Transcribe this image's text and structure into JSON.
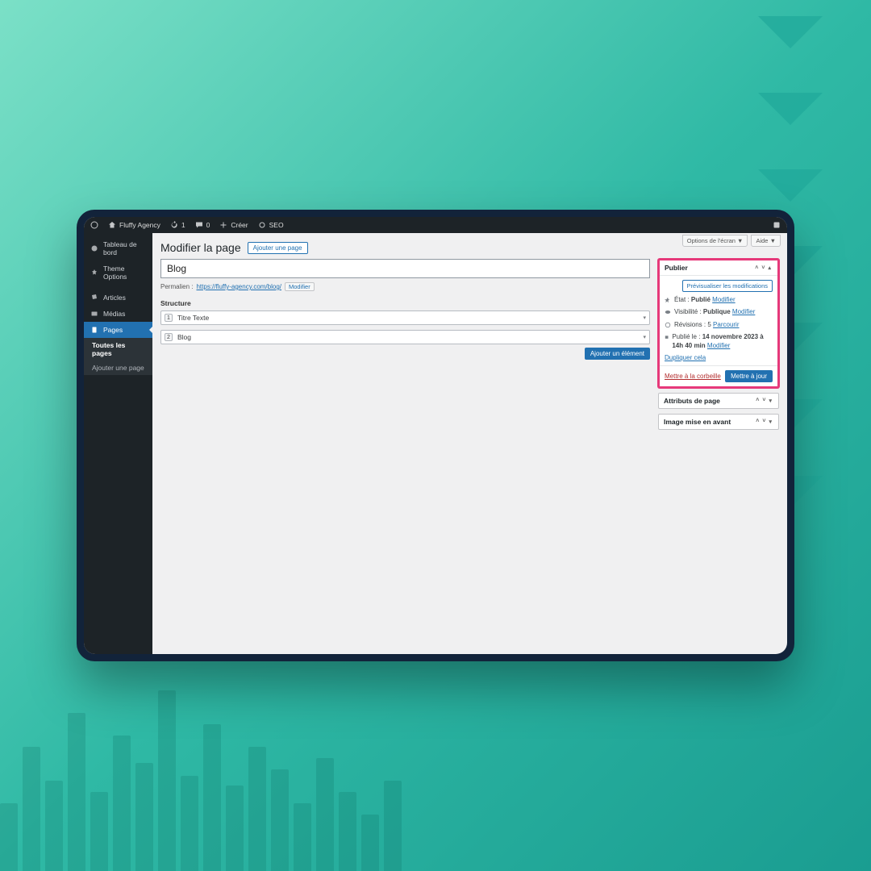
{
  "adminbar": {
    "site_name": "Fluffy Agency",
    "updates_count": "1",
    "comments_count": "0",
    "new_label": "Créer",
    "seo_label": "SEO"
  },
  "sidebar": [
    {
      "id": "dashboard",
      "label": "Tableau de bord"
    },
    {
      "id": "theme",
      "label": "Theme Options"
    },
    {
      "id": "posts",
      "label": "Articles"
    },
    {
      "id": "media",
      "label": "Médias"
    },
    {
      "id": "pages",
      "label": "Pages",
      "active": true
    }
  ],
  "submenu": [
    {
      "id": "all",
      "label": "Toutes les pages",
      "current": true
    },
    {
      "id": "add",
      "label": "Ajouter une page"
    }
  ],
  "screen_options_label": "Options de l'écran",
  "help_label": "Aide",
  "page_heading": "Modifier la page",
  "add_page_button": "Ajouter une page",
  "title_value": "Blog",
  "permalink_label": "Permalien :",
  "permalink_url": "https://fluffy-agency.com/blog/",
  "permalink_edit": "Modifier",
  "structure_label": "Structure",
  "blocks": [
    {
      "num": "1",
      "label": "Titre Texte"
    },
    {
      "num": "2",
      "label": "Blog"
    }
  ],
  "add_element_button": "Ajouter un élément",
  "publish_box": {
    "title": "Publier",
    "preview_button": "Prévisualiser les modifications",
    "state_label": "État :",
    "state_value": "Publié",
    "state_edit": "Modifier",
    "visibility_label": "Visibilité :",
    "visibility_value": "Publique",
    "visibility_edit": "Modifier",
    "revisions_label": "Révisions :",
    "revisions_value": "5",
    "revisions_browse": "Parcourir",
    "published_label": "Publié le :",
    "published_value": "14 novembre 2023 à 14h 40 min",
    "published_edit": "Modifier",
    "duplicate_link": "Dupliquer cela",
    "trash_link": "Mettre à la corbeille",
    "update_button": "Mettre à jour"
  },
  "attributes_box_title": "Attributs de page",
  "featured_box_title": "Image mise en avant"
}
